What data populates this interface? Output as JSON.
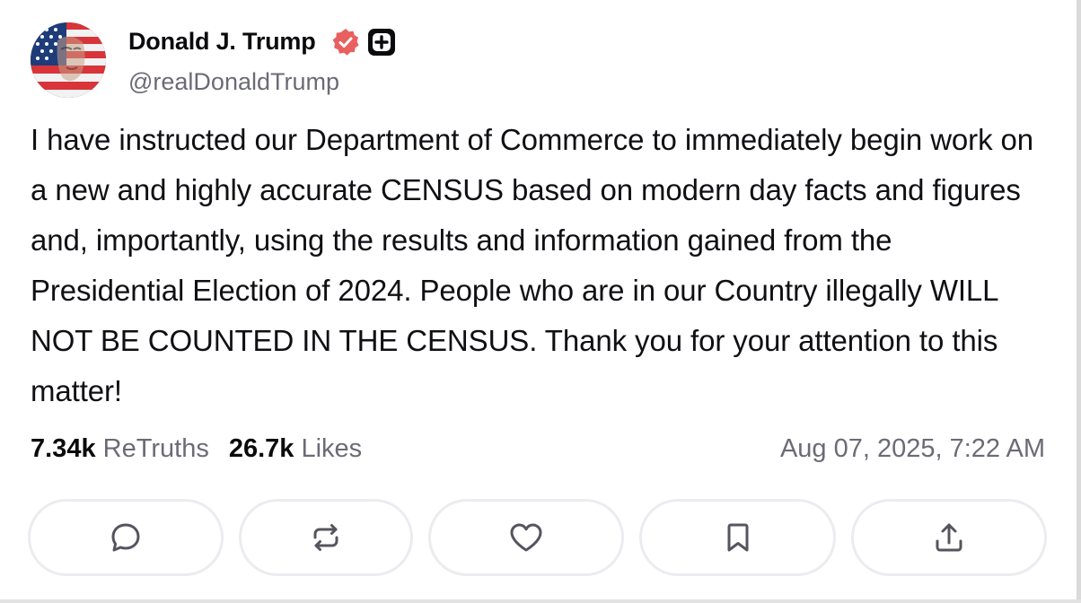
{
  "author": {
    "name": "Donald J. Trump",
    "handle": "@realDonaldTrump",
    "avatar_icon": "flag-portrait-avatar",
    "verified_icon": "verified-badge-icon",
    "plus_icon": "plus-badge-icon"
  },
  "post": {
    "text": "I have instructed our Department of Commerce to immediately begin work on a new and highly accurate CENSUS based on modern day facts and figures and, importantly, using the results and information gained from the Presidential Election of 2024. People who are in our Country illegally WILL NOT BE COUNTED IN THE CENSUS. Thank you for your attention to this matter!"
  },
  "stats": {
    "retruths_count": "7.34k",
    "retruths_label": "ReTruths",
    "likes_count": "26.7k",
    "likes_label": "Likes",
    "timestamp": "Aug 07, 2025, 7:22 AM"
  },
  "actions": [
    {
      "icon": "reply-icon"
    },
    {
      "icon": "retruth-icon"
    },
    {
      "icon": "heart-icon"
    },
    {
      "icon": "bookmark-icon"
    },
    {
      "icon": "share-icon"
    }
  ],
  "colors": {
    "verified": "#e8605f",
    "text_primary": "#0f0f12",
    "text_secondary": "#6b6b76",
    "button_border": "#ececf0",
    "icon_color": "#55555f"
  }
}
